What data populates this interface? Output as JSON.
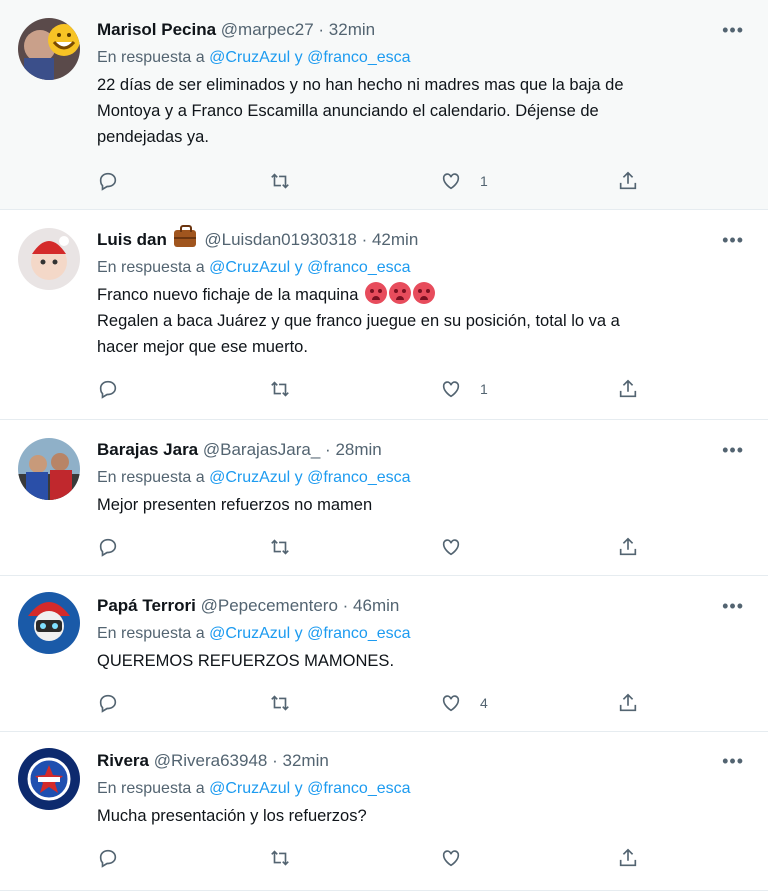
{
  "reply_prefix": "En respuesta a",
  "colors": {
    "mention": "#1d9bf0",
    "secondary": "#536471",
    "divider": "#e6ecf0",
    "highlight_bg": "#f7f9f9"
  },
  "tweets": [
    {
      "name": "Marisol Pecina",
      "handle": "@marpec27",
      "time": "32min",
      "mention": "@CruzAzul y @franco_esca",
      "body_lines": [
        "22 días de ser eliminados y no han hecho ni madres mas que la baja de",
        "Montoya y a Franco Escamilla anunciando el calendario. Déjense de",
        "pendejadas ya."
      ],
      "likes": "1"
    },
    {
      "name": "Luis dan",
      "badge_icon": "briefcase-icon",
      "handle": "@Luisdan01930318",
      "time": "42min",
      "mention": "@CruzAzul y @franco_esca",
      "body_lines": [
        "Franco nuevo fichaje de la maquina",
        "Regalen a baca Juárez y que franco juegue en su posición, total lo va a",
        "hacer mejor que ese muerto."
      ],
      "body_emoji_icon": "angry-face-icon",
      "likes": "1"
    },
    {
      "name": "Barajas Jara",
      "handle": "@BarajasJara_",
      "time": "28min",
      "mention": "@CruzAzul y @franco_esca",
      "body_lines": [
        "Mejor presenten refuerzos no mamen"
      ],
      "likes": ""
    },
    {
      "name": "Papá Terrori",
      "handle": "@Pepecementero",
      "time": "46min",
      "mention": "@CruzAzul y @franco_esca",
      "body_lines": [
        "QUEREMOS REFUERZOS MAMONES."
      ],
      "likes": "4"
    },
    {
      "name": "Rivera",
      "handle": "@Rivera63948",
      "time": "32min",
      "mention": "@CruzAzul y @franco_esca",
      "body_lines": [
        "Mucha presentación y los refuerzos?"
      ],
      "likes": ""
    }
  ],
  "icons": {
    "more": "more-icon",
    "reply": "reply-icon",
    "retweet": "retweet-icon",
    "like": "like-icon",
    "share": "share-icon"
  }
}
